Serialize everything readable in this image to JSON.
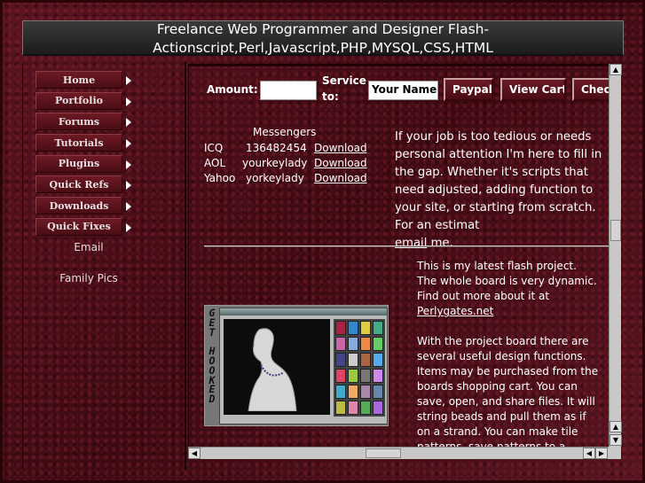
{
  "header": {
    "title": "Freelance Web Programmer and Designer Flash-Actionscript,Perl,Javascript,PHP,MYSQL,CSS,HTML"
  },
  "nav": {
    "items": [
      {
        "label": "Home"
      },
      {
        "label": "Portfolio"
      },
      {
        "label": "Forums"
      },
      {
        "label": "Tutorials"
      },
      {
        "label": "Plugins"
      },
      {
        "label": "Quick Refs"
      },
      {
        "label": "Downloads"
      },
      {
        "label": "Quick Fixes"
      }
    ],
    "email": "Email",
    "family_pics": "Family Pics"
  },
  "payment": {
    "amount_label": "Amount:",
    "amount_value": "",
    "service_label_1": "Service",
    "service_label_2": "to:",
    "name_value": "Your Name",
    "paypal_button": "Paypal",
    "viewcart_button": "View Cart",
    "checkout_button": "Check"
  },
  "messengers": {
    "heading": "Messengers",
    "rows": [
      {
        "service": "ICQ",
        "id": "136482454",
        "link": "Download"
      },
      {
        "service": "AOL",
        "id": "yourkeylady",
        "link": "Download"
      },
      {
        "service": "Yahoo",
        "id": "yorkeylady",
        "link": "Download"
      }
    ]
  },
  "pitch": {
    "text_before": "If your job is too tedious or needs personal attention I'm here to fill in the gap. Whether it's scripts that need adjusted, adding function to your site, or starting from scratch. For an estimat",
    "link": "email",
    "text_after": " me."
  },
  "flash_project": {
    "vertical_text": "GET HOOKED",
    "para1_before": "This is my latest flash project. The whole board is very dynamic. Find out more about it at ",
    "para1_link": "Perlygates.net",
    "para2": "With the project board there are several useful design functions. Items may be purchased from the boards shopping cart. You can save, open, and share files. It will string beads and pull them as if on a strand. You can make tile patterns, save patterns to a"
  },
  "colors": {
    "background": "#4a0f16",
    "header_bg": "#2a2a2a",
    "button_bg": "#5a1520",
    "text": "#ffffff"
  },
  "icons": {
    "nav_arrow": "triangle-right-icon",
    "scroll_up": "arrow-up-icon",
    "scroll_down": "arrow-down-icon",
    "scroll_left": "arrow-left-icon",
    "scroll_right": "arrow-right-icon"
  }
}
